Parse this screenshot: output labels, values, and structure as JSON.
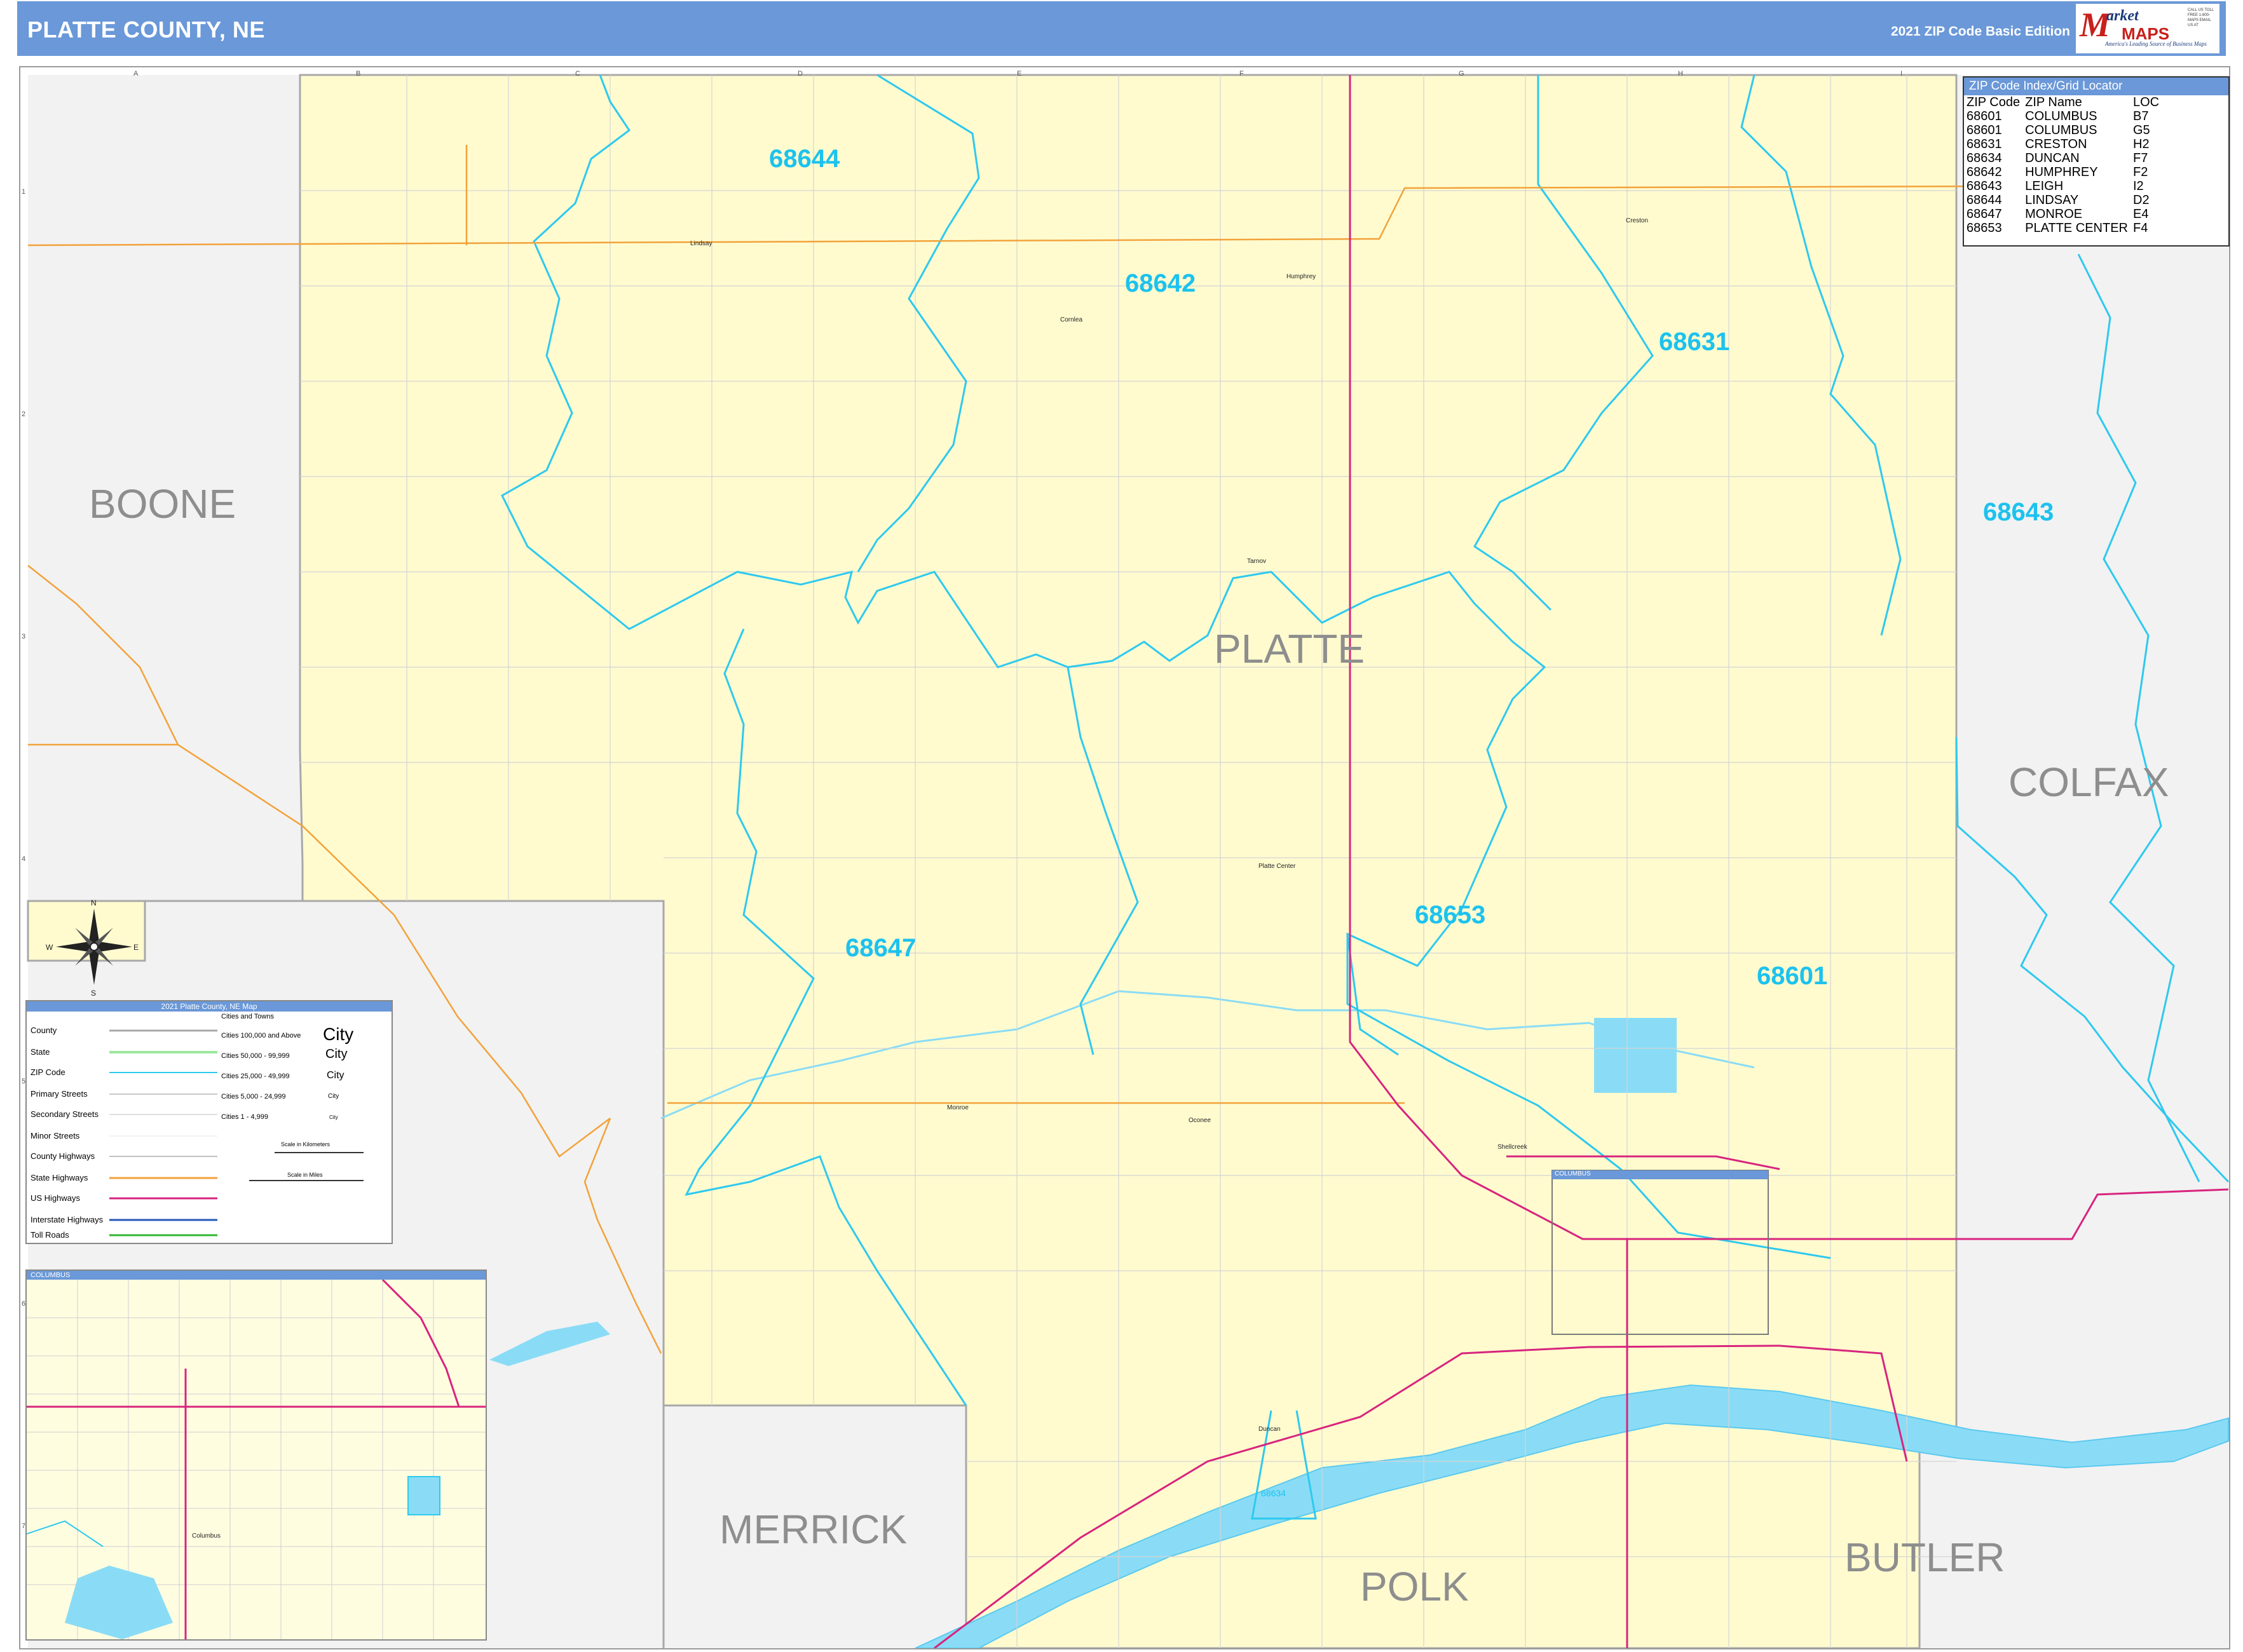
{
  "header": {
    "title": "PLATTE COUNTY, NE",
    "edition": "2021 ZIP Code Basic Edition"
  },
  "logo": {
    "m": "M",
    "market": "arket",
    "maps": "MAPS",
    "tagline": "America's Leading Source of Business Maps",
    "slogan": "On Target, On Time.",
    "contact": "CALL US TOLL FREE 1-800-MAPS EMAIL US AT"
  },
  "grid": {
    "columns": [
      "A",
      "B",
      "C",
      "D",
      "E",
      "F",
      "G",
      "H",
      "I"
    ],
    "rows": [
      "1",
      "2",
      "3",
      "4",
      "5",
      "6",
      "7"
    ]
  },
  "counties": {
    "main": "PLATTE",
    "boone": "BOONE",
    "colfax": "COLFAX",
    "merrick": "MERRICK",
    "polk": "POLK",
    "butler": "BUTLER"
  },
  "zips": {
    "z68644": "68644",
    "z68642": "68642",
    "z68631": "68631",
    "z68643": "68643",
    "z68647": "68647",
    "z68653": "68653",
    "z68601": "68601",
    "z68634": "68634"
  },
  "towns": {
    "lindsay": "Lindsay",
    "cornlea": "Cornlea",
    "humphrey": "Humphrey",
    "creston": "Creston",
    "tarnov": "Tarnov",
    "platte_center": "Platte Center",
    "monroe": "Monroe",
    "oconee": "Oconee",
    "shell_creek": "Shellcreek",
    "duncan": "Duncan",
    "columbus": "Columbus"
  },
  "zip_index": {
    "title": "ZIP Code Index/Grid Locator",
    "headers": [
      "ZIP Code",
      "ZIP Name",
      "LOC"
    ],
    "rows": [
      [
        "68601",
        "COLUMBUS",
        "B7"
      ],
      [
        "68601",
        "COLUMBUS",
        "G5"
      ],
      [
        "68631",
        "CRESTON",
        "H2"
      ],
      [
        "68634",
        "DUNCAN",
        "F7"
      ],
      [
        "68642",
        "HUMPHREY",
        "F2"
      ],
      [
        "68643",
        "LEIGH",
        "I2"
      ],
      [
        "68644",
        "LINDSAY",
        "D2"
      ],
      [
        "68647",
        "MONROE",
        "E4"
      ],
      [
        "68653",
        "PLATTE CENTER",
        "F4"
      ]
    ]
  },
  "legend": {
    "title": "2021 Platte County, NE Map",
    "items": [
      {
        "label": "County",
        "color": "#a8a8a8"
      },
      {
        "label": "State",
        "color": "#9de89d"
      },
      {
        "label": "ZIP Code",
        "color": "#2ec9ef"
      },
      {
        "label": "Primary Streets",
        "color": "#c8c8c8"
      },
      {
        "label": "Secondary Streets",
        "color": "#d6d6d6"
      },
      {
        "label": "Minor Streets",
        "color": "#e4e4e4"
      },
      {
        "label": "County Highways",
        "color": "#c0c0c0"
      },
      {
        "label": "State Highways",
        "color": "#f2a23a"
      },
      {
        "label": "US Highways",
        "color": "#d8247e"
      },
      {
        "label": "Interstate Highways",
        "color": "#2259b8"
      },
      {
        "label": "Toll Roads",
        "color": "#2fb52f"
      }
    ],
    "cities_header": "Cities and Towns",
    "cities": [
      {
        "label": "Cities 100,000 and Above",
        "sample": "City"
      },
      {
        "label": "Cities 50,000 - 99,999",
        "sample": "City"
      },
      {
        "label": "Cities 25,000 - 49,999",
        "sample": "City"
      },
      {
        "label": "Cities 5,000 - 24,999",
        "sample": "City"
      },
      {
        "label": "Cities 1 - 4,999",
        "sample": "City"
      }
    ],
    "scale_km": "Scale in Kilometers",
    "scale_mi": "Scale in Miles"
  },
  "compass": {
    "n": "N",
    "s": "S",
    "e": "E",
    "w": "W"
  },
  "inset": {
    "title": "COLUMBUS",
    "columbus_label": "Columbus"
  },
  "columbus_box_title": "COLUMBUS",
  "colors": {
    "header": "#6a98d8",
    "county_fill": "#fffbcf",
    "neighbor_fill": "#f2f2f2",
    "zip_line": "#2ec9ef",
    "state_highway": "#f2a23a",
    "us_highway": "#d8247e",
    "water": "#8adcf6"
  }
}
